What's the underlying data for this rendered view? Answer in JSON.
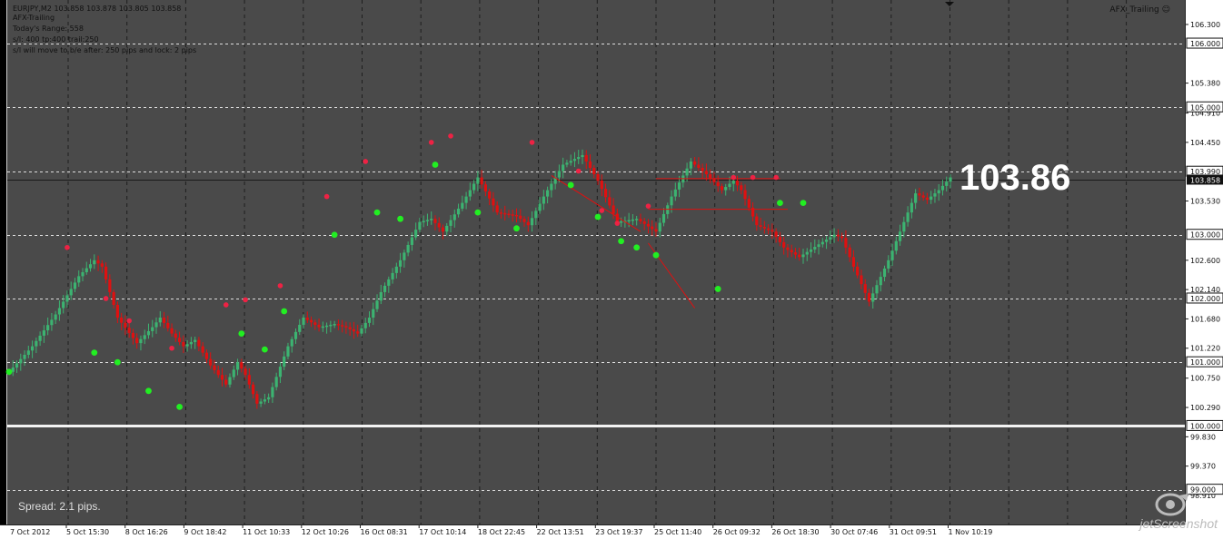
{
  "header": {
    "symbol_line": "EURJPY,M2  103.858 103.878 103.805 103.858",
    "indicator_line": "AFX-Trailing",
    "range_line": "Today's Range: 558",
    "sl_line": "s/l: 400  tp:400  trail:250",
    "be_line": "s/l will move to b/e after: 250 pips    and lock: 2 pips"
  },
  "indicator_name": "AFX_Trailing",
  "big_price": "103.86",
  "spread_text": "Spread: 2.1 pips.",
  "watermark": "jetScreenshot",
  "colors": {
    "background": "#4a4a4a",
    "bull": "#3cb371",
    "bear": "#e01010",
    "green_dot": "#22ee22",
    "red_dot": "#ee2244",
    "grid": "#dddddd",
    "axis_bg": "#ffffff"
  },
  "chart_data": {
    "type": "candlestick",
    "symbol": "EURJPY",
    "timeframe": "M2",
    "ylim": [
      98.454,
      106.684
    ],
    "y_ticks": [
      "106.300",
      "105.380",
      "104.910",
      "104.450",
      "103.530",
      "102.600",
      "102.140",
      "101.680",
      "101.220",
      "100.750",
      "100.290",
      "99.830",
      "99.370",
      "98.910"
    ],
    "y_level_labels": [
      "106.000",
      "105.000",
      "103.990",
      "103.000",
      "102.000",
      "101.000",
      "100.000",
      "99.000"
    ],
    "current_price_label": "103.858",
    "horizontal_levels": [
      106.0,
      105.0,
      103.99,
      103.0,
      102.0,
      101.0,
      100.0,
      99.0
    ],
    "strong_level": 100.0,
    "current_price": 103.858,
    "x_labels": [
      "7 Oct 2012",
      "5 Oct 15:30",
      "8 Oct 16:26",
      "9 Oct 18:42",
      "11 Oct 10:33",
      "12 Oct 10:26",
      "16 Oct 08:31",
      "17 Oct 10:14",
      "18 Oct 22:45",
      "22 Oct 13:51",
      "23 Oct 19:37",
      "25 Oct 11:40",
      "26 Oct 09:32",
      "26 Oct 18:30",
      "30 Oct 07:46",
      "31 Oct 09:51",
      "1 Nov 10:19"
    ],
    "path_points": [
      [
        0,
        100.85
      ],
      [
        6,
        101.25
      ],
      [
        12,
        101.75
      ],
      [
        18,
        102.35
      ],
      [
        22,
        102.6
      ],
      [
        24,
        102.5
      ],
      [
        28,
        101.7
      ],
      [
        33,
        101.3
      ],
      [
        37,
        101.55
      ],
      [
        39,
        101.7
      ],
      [
        42,
        101.45
      ],
      [
        45,
        101.25
      ],
      [
        48,
        101.35
      ],
      [
        52,
        100.95
      ],
      [
        56,
        100.65
      ],
      [
        59,
        101.0
      ],
      [
        61,
        100.8
      ],
      [
        64,
        100.35
      ],
      [
        67,
        100.45
      ],
      [
        72,
        101.25
      ],
      [
        76,
        101.7
      ],
      [
        80,
        101.55
      ],
      [
        84,
        101.6
      ],
      [
        87,
        101.55
      ],
      [
        90,
        101.45
      ],
      [
        93,
        101.7
      ],
      [
        96,
        102.1
      ],
      [
        101,
        102.6
      ],
      [
        106,
        103.2
      ],
      [
        109,
        103.25
      ],
      [
        112,
        103.05
      ],
      [
        117,
        103.5
      ],
      [
        121,
        103.9
      ],
      [
        126,
        103.35
      ],
      [
        131,
        103.3
      ],
      [
        134,
        103.15
      ],
      [
        138,
        103.6
      ],
      [
        143,
        104.1
      ],
      [
        148,
        104.25
      ],
      [
        152,
        103.85
      ],
      [
        157,
        103.2
      ],
      [
        162,
        103.25
      ],
      [
        167,
        103.05
      ],
      [
        171,
        103.6
      ],
      [
        176,
        104.15
      ],
      [
        180,
        103.95
      ],
      [
        184,
        103.7
      ],
      [
        187,
        103.85
      ],
      [
        189,
        103.7
      ],
      [
        193,
        103.15
      ],
      [
        197,
        103.05
      ],
      [
        200,
        102.8
      ],
      [
        204,
        102.65
      ],
      [
        209,
        102.85
      ],
      [
        213,
        103.0
      ],
      [
        215,
        102.95
      ],
      [
        218,
        102.5
      ],
      [
        222,
        101.95
      ],
      [
        227,
        102.6
      ],
      [
        231,
        103.2
      ],
      [
        234,
        103.65
      ],
      [
        237,
        103.55
      ],
      [
        240,
        103.7
      ],
      [
        243,
        103.9
      ]
    ],
    "green_dots": [
      [
        0,
        100.85
      ],
      [
        22,
        101.15
      ],
      [
        28,
        101.0
      ],
      [
        36,
        100.55
      ],
      [
        44,
        100.3
      ],
      [
        60,
        101.45
      ],
      [
        66,
        101.2
      ],
      [
        71,
        101.8
      ],
      [
        84,
        103.0
      ],
      [
        95,
        103.35
      ],
      [
        101,
        103.25
      ],
      [
        110,
        104.1
      ],
      [
        121,
        103.35
      ],
      [
        131,
        103.1
      ],
      [
        145,
        103.78
      ],
      [
        152,
        103.28
      ],
      [
        158,
        102.9
      ],
      [
        162,
        102.8
      ],
      [
        167,
        102.68
      ],
      [
        183,
        102.15
      ],
      [
        199,
        103.5
      ],
      [
        205,
        103.5
      ]
    ],
    "red_dots": [
      [
        15,
        102.8
      ],
      [
        25,
        102.0
      ],
      [
        31,
        101.65
      ],
      [
        42,
        101.22
      ],
      [
        56,
        101.9
      ],
      [
        61,
        101.98
      ],
      [
        70,
        102.2
      ],
      [
        82,
        103.6
      ],
      [
        92,
        104.15
      ],
      [
        109,
        104.45
      ],
      [
        114,
        104.55
      ],
      [
        135,
        104.45
      ],
      [
        147,
        104.0
      ],
      [
        153,
        103.38
      ],
      [
        157,
        103.18
      ],
      [
        165,
        103.45
      ],
      [
        187,
        103.9
      ],
      [
        192,
        103.9
      ],
      [
        198,
        103.9
      ]
    ],
    "trend_lines": [
      {
        "points": [
          [
            165,
            102.87
          ],
          [
            177,
            101.85
          ]
        ],
        "color": "#e01010"
      },
      {
        "points": [
          [
            140,
            103.93
          ],
          [
            163,
            103.05
          ]
        ],
        "color": "#e01010"
      }
    ],
    "resistance_lines": [
      {
        "from": 165,
        "to": 201,
        "price": 103.4,
        "color": "#e01010"
      },
      {
        "from": 167,
        "to": 199,
        "price": 103.88,
        "color": "#e01010"
      }
    ],
    "grid": true,
    "num_bars": 244
  }
}
